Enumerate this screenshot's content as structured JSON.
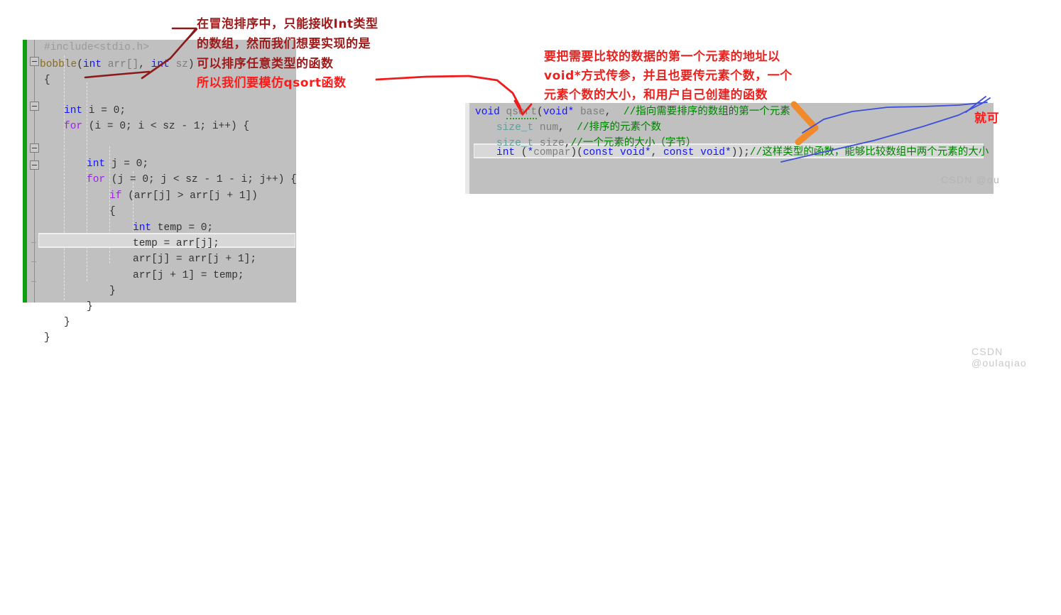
{
  "left_editor": {
    "name": "bubble-sort-code",
    "lines": [
      {
        "text": "#include<stdio.h>",
        "kind": "preprocessor"
      },
      {
        "text": "bobble(int arr[], int sz)",
        "kind": "signature"
      },
      {
        "text": "{",
        "kind": "brace"
      },
      {
        "text": "int i = 0;",
        "kind": "stmt"
      },
      {
        "text": "for (i = 0; i < sz - 1; i++) {",
        "kind": "loop"
      },
      {
        "text": "int j = 0;",
        "kind": "stmt"
      },
      {
        "text": "for (j = 0; j < sz - 1 - i; j++) {",
        "kind": "loop"
      },
      {
        "text": "if (arr[j] > arr[j + 1])",
        "kind": "cond"
      },
      {
        "text": "{",
        "kind": "brace"
      },
      {
        "text": "int temp = 0;",
        "kind": "stmt"
      },
      {
        "text": "temp = arr[j];",
        "kind": "stmt"
      },
      {
        "text": "arr[j] = arr[j + 1];",
        "kind": "stmt"
      },
      {
        "text": "arr[j + 1] = temp;",
        "kind": "stmt-highlighted"
      },
      {
        "text": "}",
        "kind": "brace"
      },
      {
        "text": "}",
        "kind": "brace"
      },
      {
        "text": "}",
        "kind": "brace"
      },
      {
        "text": "}",
        "kind": "brace"
      }
    ],
    "highlighted_line": "arr[j + 1] = temp;",
    "tokens": {
      "include": "#include<stdio.h>",
      "fn_name": "bobble",
      "p1_type": "int",
      "p1_name": "arr[]",
      "p2_type": "int",
      "p2_name": "sz",
      "kw_int": "int",
      "kw_for": "for",
      "kw_if": "if"
    }
  },
  "right_editor": {
    "name": "qsort-prototype-code",
    "lines": [
      {
        "code": "void qsort(void* base,",
        "comment": "//指向需要排序的数组的第一个元素"
      },
      {
        "code": "size_t num,",
        "comment": "//排序的元素个数"
      },
      {
        "code": "size_t size,",
        "comment": "//一个元素的大小（字节）"
      },
      {
        "code": "int (*compar)(const void*, const void*));",
        "comment": "//这样类型的函数，能够比较数组中两个元素的大小"
      }
    ],
    "highlighted_line": "int (*compar)(const void*, const void*));",
    "tokens": {
      "void": "void",
      "qsort": "qsort",
      "base": "base",
      "size_t": "size_t",
      "num": "num",
      "size": "size",
      "int": "int",
      "compar": "compar",
      "const": "const"
    }
  },
  "annotations": {
    "note_top_left": {
      "lines": [
        "在冒泡排序中，只能接收Int类型",
        "的数组，然而我们想要实现的是",
        "可以排序任意类型的函数"
      ],
      "color": "#9e1a1a"
    },
    "note_top_left_red": {
      "line": "所以我们要模仿qsort函数",
      "color": "#ff1a1a"
    },
    "note_right": {
      "lines": [
        "要把需要比较的数据的第一个元素的地址以",
        "void*方式传参，并且也要传元素个数，一个",
        "元素个数的大小，和用户自己创建的函数"
      ],
      "color": "#e8231f"
    },
    "note_far_right_clipped": {
      "line": "就可",
      "color": "#ff1a1a"
    }
  },
  "watermarks": {
    "main": "CSDN @oulaqiao",
    "inner": "CSDN @ou"
  },
  "colors": {
    "editor_bg": "#c0c0c0",
    "change_bar": "#0ea00e",
    "highlight_bg": "#d8d8d8",
    "arrow_dark_red": "#8b1a1a",
    "arrow_red": "#e8231f",
    "arrow_orange": "#f08a2c",
    "arrow_blue": "#3b4fd8",
    "keyword_blue": "#1414ff",
    "keyword_purple": "#a020f0",
    "comment_green": "#008000"
  }
}
